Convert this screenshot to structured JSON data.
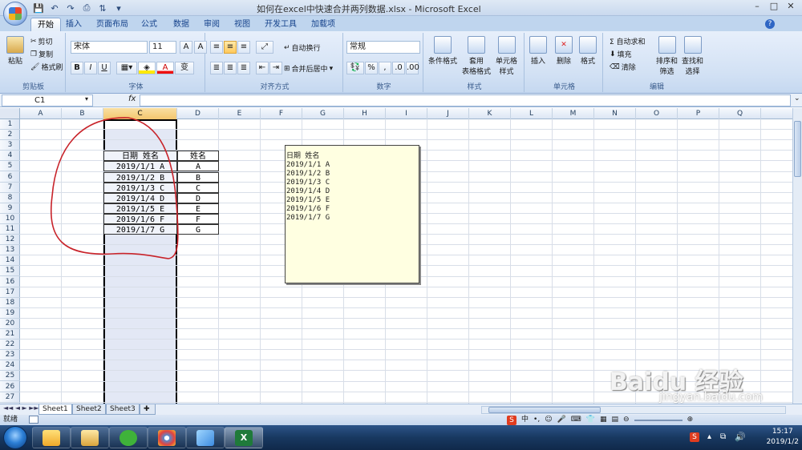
{
  "window": {
    "title": "如何在excel中快速合并两列数据.xlsx - Microsoft Excel",
    "min": "–",
    "max": "□",
    "close": "✕"
  },
  "tabs": [
    "开始",
    "插入",
    "页面布局",
    "公式",
    "数据",
    "审阅",
    "视图",
    "开发工具",
    "加载项"
  ],
  "ribbon": {
    "clipboard": {
      "label": "剪贴板",
      "paste": "粘贴",
      "cut": "剪切",
      "copy": "复制",
      "format_painter": "格式刷"
    },
    "font": {
      "label": "字体",
      "name": "宋体",
      "size": "11",
      "bold": "B",
      "italic": "I",
      "underline": "U"
    },
    "align": {
      "label": "对齐方式",
      "wrap": "自动换行",
      "merge": "合并后居中"
    },
    "number": {
      "label": "数字",
      "format": "常规",
      "percent": "%"
    },
    "styles": {
      "label": "样式",
      "cond": "条件格式",
      "table_fmt": "套用\n表格格式",
      "cell_style": "单元格\n样式"
    },
    "cells": {
      "label": "单元格",
      "insert": "插入",
      "delete": "删除",
      "format": "格式"
    },
    "editing": {
      "label": "编辑",
      "autosum": "Σ 自动求和",
      "fill": "填充",
      "clear": "清除",
      "sort": "排序和\n筛选",
      "find": "查找和\n选择"
    }
  },
  "formula_bar": {
    "name_box": "C1",
    "fx": "fx",
    "content": ""
  },
  "columns": [
    "A",
    "B",
    "C",
    "D",
    "E",
    "F",
    "G",
    "H",
    "I",
    "J",
    "K",
    "L",
    "M",
    "N",
    "O",
    "P",
    "Q"
  ],
  "selected_column": "C",
  "rows": [
    "1",
    "2",
    "3",
    "4",
    "5",
    "6",
    "7",
    "8",
    "9",
    "10",
    "11",
    "12",
    "13",
    "14",
    "15",
    "16",
    "17",
    "18",
    "19",
    "20",
    "21",
    "22",
    "23",
    "24",
    "25",
    "26",
    "27"
  ],
  "table": {
    "header_c": "日期 姓名",
    "header_d": "姓名",
    "c_values": [
      "2019/1/1 A",
      "2019/1/2 B",
      "2019/1/3 C",
      "2019/1/4 D",
      "2019/1/5 E",
      "2019/1/6 F",
      "2019/1/7 G"
    ],
    "d_values": [
      "A",
      "B",
      "C",
      "D",
      "E",
      "F",
      "G"
    ]
  },
  "textbox_lines": [
    "日期 姓名",
    "2019/1/1 A",
    "2019/1/2 B",
    "2019/1/3 C",
    "2019/1/4 D",
    "2019/1/5 E",
    "2019/1/6 F",
    "2019/1/7 G"
  ],
  "sheets": [
    "Sheet1",
    "Sheet2",
    "Sheet3"
  ],
  "active_sheet": "Sheet1",
  "status": {
    "ready": "就绪"
  },
  "watermark": "Baidu 经验",
  "watermark_url": "jingyan.baidu.com",
  "clock": {
    "time": "15:17",
    "date": "2019/1/2"
  },
  "colors": {
    "selection_col": "#e3e8f5",
    "annotation": "#c8232a",
    "textbox_bg": "#ffffe1"
  }
}
